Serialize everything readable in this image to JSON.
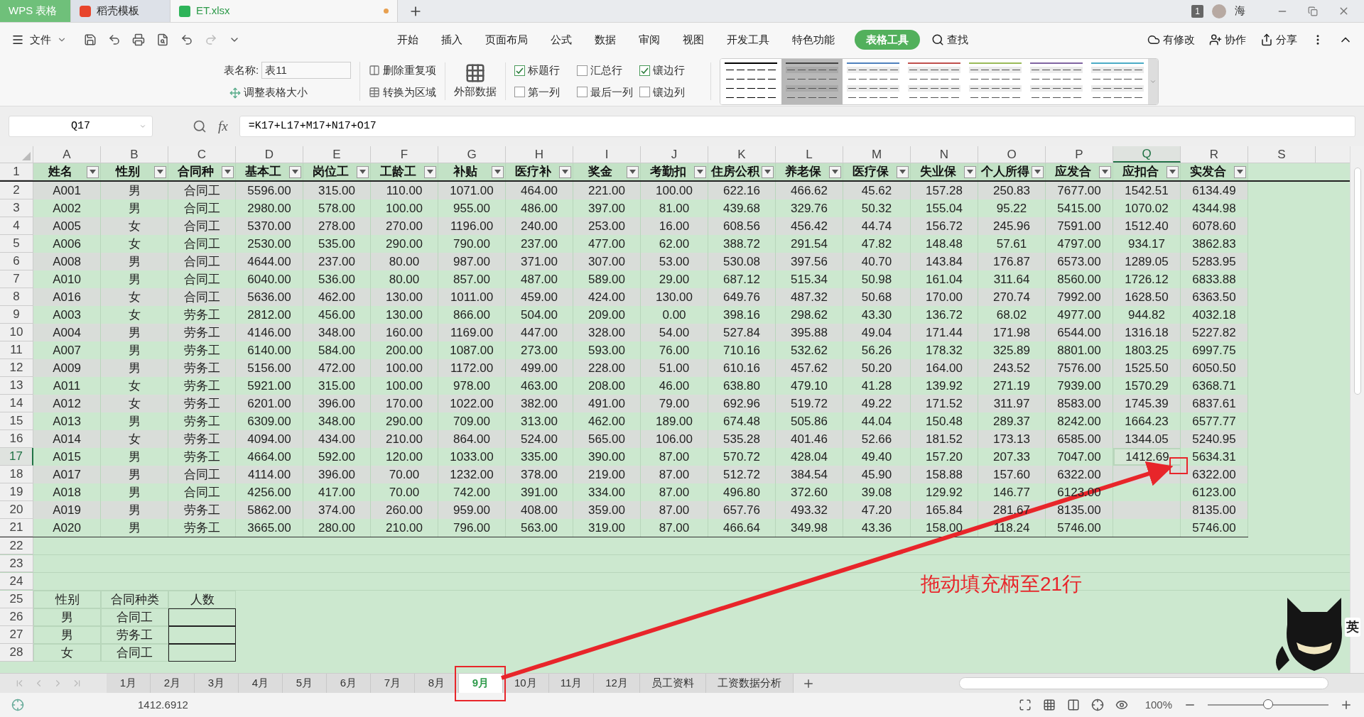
{
  "app_tabs": [
    {
      "label": "WPS 表格",
      "kind": "home",
      "selected": false
    },
    {
      "label": "稻壳模板",
      "kind": "docer",
      "selected": false
    },
    {
      "label": "ET.xlsx",
      "kind": "file",
      "selected": true
    }
  ],
  "title_bar": {
    "badge": "1",
    "user": "海"
  },
  "menu": {
    "file": "文件",
    "tabs": [
      {
        "label": "开始",
        "selected": false
      },
      {
        "label": "插入",
        "selected": false
      },
      {
        "label": "页面布局",
        "selected": false
      },
      {
        "label": "公式",
        "selected": false
      },
      {
        "label": "数据",
        "selected": false
      },
      {
        "label": "审阅",
        "selected": false
      },
      {
        "label": "视图",
        "selected": false
      },
      {
        "label": "开发工具",
        "selected": false
      },
      {
        "label": "特色功能",
        "selected": false
      },
      {
        "label": "表格工具",
        "selected": true
      }
    ],
    "search": "查找",
    "actions": [
      "有修改",
      "协作",
      "分享"
    ]
  },
  "ribbon": {
    "table_name_label": "表名称:",
    "table_name": "表11",
    "resize": "调整表格大小",
    "remove_duplicates": "删除重复项",
    "convert": "转换为区域",
    "external_data": "外部数据",
    "options": [
      {
        "label": "标题行",
        "checked": true
      },
      {
        "label": "汇总行",
        "checked": false
      },
      {
        "label": "镶边行",
        "checked": true
      },
      {
        "label": "第一列",
        "checked": false
      },
      {
        "label": "最后一列",
        "checked": false
      },
      {
        "label": "镶边列",
        "checked": false
      }
    ],
    "styles": [
      {
        "color": "#000000",
        "selected": false
      },
      {
        "color": "#444444",
        "selected": true
      },
      {
        "color": "#4f81bd",
        "selected": false
      },
      {
        "color": "#c0504d",
        "selected": false
      },
      {
        "color": "#9bbb59",
        "selected": false
      },
      {
        "color": "#8064a2",
        "selected": false
      },
      {
        "color": "#4bacc6",
        "selected": false
      }
    ]
  },
  "formula_bar": {
    "cell": "Q17",
    "fx": "fx",
    "formula": "=K17+L17+M17+N17+O17"
  },
  "sheet": {
    "columns": [
      {
        "label": "A",
        "selected": false
      },
      {
        "label": "B",
        "selected": false
      },
      {
        "label": "C",
        "selected": false
      },
      {
        "label": "D",
        "selected": false
      },
      {
        "label": "E",
        "selected": false
      },
      {
        "label": "F",
        "selected": false
      },
      {
        "label": "G",
        "selected": false
      },
      {
        "label": "H",
        "selected": false
      },
      {
        "label": "I",
        "selected": false
      },
      {
        "label": "J",
        "selected": false
      },
      {
        "label": "K",
        "selected": false
      },
      {
        "label": "L",
        "selected": false
      },
      {
        "label": "M",
        "selected": false
      },
      {
        "label": "N",
        "selected": false
      },
      {
        "label": "O",
        "selected": false
      },
      {
        "label": "P",
        "selected": false
      },
      {
        "label": "Q",
        "selected": true
      },
      {
        "label": "R",
        "selected": false
      },
      {
        "label": "S",
        "selected": false
      }
    ],
    "header_row": {
      "number": "1",
      "cells": [
        "姓名",
        "性别",
        "合同种",
        "基本工",
        "岗位工",
        "工龄工",
        "补贴",
        "医疗补",
        "奖金",
        "考勤扣",
        "住房公积",
        "养老保",
        "医疗保",
        "失业保",
        "个人所得",
        "应发合",
        "应扣合",
        "实发合"
      ]
    },
    "rows": [
      {
        "number": "2",
        "selected": false,
        "cells": [
          "A001",
          "男",
          "合同工",
          "5596.00",
          "315.00",
          "110.00",
          "1071.00",
          "464.00",
          "221.00",
          "100.00",
          "622.16",
          "466.62",
          "45.62",
          "157.28",
          "250.83",
          "7677.00",
          "1542.51",
          "6134.49"
        ]
      },
      {
        "number": "3",
        "selected": false,
        "cells": [
          "A002",
          "男",
          "合同工",
          "2980.00",
          "578.00",
          "100.00",
          "955.00",
          "486.00",
          "397.00",
          "81.00",
          "439.68",
          "329.76",
          "50.32",
          "155.04",
          "95.22",
          "5415.00",
          "1070.02",
          "4344.98"
        ]
      },
      {
        "number": "4",
        "selected": false,
        "cells": [
          "A005",
          "女",
          "合同工",
          "5370.00",
          "278.00",
          "270.00",
          "1196.00",
          "240.00",
          "253.00",
          "16.00",
          "608.56",
          "456.42",
          "44.74",
          "156.72",
          "245.96",
          "7591.00",
          "1512.40",
          "6078.60"
        ]
      },
      {
        "number": "5",
        "selected": false,
        "cells": [
          "A006",
          "女",
          "合同工",
          "2530.00",
          "535.00",
          "290.00",
          "790.00",
          "237.00",
          "477.00",
          "62.00",
          "388.72",
          "291.54",
          "47.82",
          "148.48",
          "57.61",
          "4797.00",
          "934.17",
          "3862.83"
        ]
      },
      {
        "number": "6",
        "selected": false,
        "cells": [
          "A008",
          "男",
          "合同工",
          "4644.00",
          "237.00",
          "80.00",
          "987.00",
          "371.00",
          "307.00",
          "53.00",
          "530.08",
          "397.56",
          "40.70",
          "143.84",
          "176.87",
          "6573.00",
          "1289.05",
          "5283.95"
        ]
      },
      {
        "number": "7",
        "selected": false,
        "cells": [
          "A010",
          "男",
          "合同工",
          "6040.00",
          "536.00",
          "80.00",
          "857.00",
          "487.00",
          "589.00",
          "29.00",
          "687.12",
          "515.34",
          "50.98",
          "161.04",
          "311.64",
          "8560.00",
          "1726.12",
          "6833.88"
        ]
      },
      {
        "number": "8",
        "selected": false,
        "cells": [
          "A016",
          "女",
          "合同工",
          "5636.00",
          "462.00",
          "130.00",
          "1011.00",
          "459.00",
          "424.00",
          "130.00",
          "649.76",
          "487.32",
          "50.68",
          "170.00",
          "270.74",
          "7992.00",
          "1628.50",
          "6363.50"
        ]
      },
      {
        "number": "9",
        "selected": false,
        "cells": [
          "A003",
          "女",
          "劳务工",
          "2812.00",
          "456.00",
          "130.00",
          "866.00",
          "504.00",
          "209.00",
          "0.00",
          "398.16",
          "298.62",
          "43.30",
          "136.72",
          "68.02",
          "4977.00",
          "944.82",
          "4032.18"
        ]
      },
      {
        "number": "10",
        "selected": false,
        "cells": [
          "A004",
          "男",
          "劳务工",
          "4146.00",
          "348.00",
          "160.00",
          "1169.00",
          "447.00",
          "328.00",
          "54.00",
          "527.84",
          "395.88",
          "49.04",
          "171.44",
          "171.98",
          "6544.00",
          "1316.18",
          "5227.82"
        ]
      },
      {
        "number": "11",
        "selected": false,
        "cells": [
          "A007",
          "男",
          "劳务工",
          "6140.00",
          "584.00",
          "200.00",
          "1087.00",
          "273.00",
          "593.00",
          "76.00",
          "710.16",
          "532.62",
          "56.26",
          "178.32",
          "325.89",
          "8801.00",
          "1803.25",
          "6997.75"
        ]
      },
      {
        "number": "12",
        "selected": false,
        "cells": [
          "A009",
          "男",
          "劳务工",
          "5156.00",
          "472.00",
          "100.00",
          "1172.00",
          "499.00",
          "228.00",
          "51.00",
          "610.16",
          "457.62",
          "50.20",
          "164.00",
          "243.52",
          "7576.00",
          "1525.50",
          "6050.50"
        ]
      },
      {
        "number": "13",
        "selected": false,
        "cells": [
          "A011",
          "女",
          "劳务工",
          "5921.00",
          "315.00",
          "100.00",
          "978.00",
          "463.00",
          "208.00",
          "46.00",
          "638.80",
          "479.10",
          "41.28",
          "139.92",
          "271.19",
          "7939.00",
          "1570.29",
          "6368.71"
        ]
      },
      {
        "number": "14",
        "selected": false,
        "cells": [
          "A012",
          "女",
          "劳务工",
          "6201.00",
          "396.00",
          "170.00",
          "1022.00",
          "382.00",
          "491.00",
          "79.00",
          "692.96",
          "519.72",
          "49.22",
          "171.52",
          "311.97",
          "8583.00",
          "1745.39",
          "6837.61"
        ]
      },
      {
        "number": "15",
        "selected": false,
        "cells": [
          "A013",
          "男",
          "劳务工",
          "6309.00",
          "348.00",
          "290.00",
          "709.00",
          "313.00",
          "462.00",
          "189.00",
          "674.48",
          "505.86",
          "44.04",
          "150.48",
          "289.37",
          "8242.00",
          "1664.23",
          "6577.77"
        ]
      },
      {
        "number": "16",
        "selected": false,
        "cells": [
          "A014",
          "女",
          "劳务工",
          "4094.00",
          "434.00",
          "210.00",
          "864.00",
          "524.00",
          "565.00",
          "106.00",
          "535.28",
          "401.46",
          "52.66",
          "181.52",
          "173.13",
          "6585.00",
          "1344.05",
          "5240.95"
        ]
      },
      {
        "number": "17",
        "selected": true,
        "cells": [
          "A015",
          "男",
          "劳务工",
          "4664.00",
          "592.00",
          "120.00",
          "1033.00",
          "335.00",
          "390.00",
          "87.00",
          "570.72",
          "428.04",
          "49.40",
          "157.20",
          "207.33",
          "7047.00",
          "1412.69",
          "5634.31"
        ]
      },
      {
        "number": "18",
        "selected": false,
        "cells": [
          "A017",
          "男",
          "合同工",
          "4114.00",
          "396.00",
          "70.00",
          "1232.00",
          "378.00",
          "219.00",
          "87.00",
          "512.72",
          "384.54",
          "45.90",
          "158.88",
          "157.60",
          "6322.00",
          null,
          "6322.00"
        ]
      },
      {
        "number": "19",
        "selected": false,
        "cells": [
          "A018",
          "男",
          "合同工",
          "4256.00",
          "417.00",
          "70.00",
          "742.00",
          "391.00",
          "334.00",
          "87.00",
          "496.80",
          "372.60",
          "39.08",
          "129.92",
          "146.77",
          "6123.00",
          null,
          "6123.00"
        ]
      },
      {
        "number": "20",
        "selected": false,
        "cells": [
          "A019",
          "男",
          "劳务工",
          "5862.00",
          "374.00",
          "260.00",
          "959.00",
          "408.00",
          "359.00",
          "87.00",
          "657.76",
          "493.32",
          "47.20",
          "165.84",
          "281.67",
          "8135.00",
          null,
          "8135.00"
        ]
      },
      {
        "number": "21",
        "selected": false,
        "cells": [
          "A020",
          "男",
          "劳务工",
          "3665.00",
          "280.00",
          "210.00",
          "796.00",
          "563.00",
          "319.00",
          "87.00",
          "466.64",
          "349.98",
          "43.36",
          "158.00",
          "118.24",
          "5746.00",
          null,
          "5746.00"
        ]
      }
    ],
    "empty_rows": [
      "22",
      "23",
      "24"
    ],
    "summary": {
      "header_number": "25",
      "header": [
        "性别",
        "合同种类",
        "人数"
      ],
      "rows": [
        {
          "number": "26",
          "cells": [
            "男",
            "合同工"
          ]
        },
        {
          "number": "27",
          "cells": [
            "男",
            "劳务工"
          ]
        },
        {
          "number": "28",
          "cells": [
            "女",
            "合同工"
          ]
        }
      ]
    }
  },
  "annotation": "拖动填充柄至21行",
  "ime": "英",
  "sheet_tabs": [
    {
      "label": "1月",
      "selected": false
    },
    {
      "label": "2月",
      "selected": false
    },
    {
      "label": "3月",
      "selected": false
    },
    {
      "label": "4月",
      "selected": false
    },
    {
      "label": "5月",
      "selected": false
    },
    {
      "label": "6月",
      "selected": false
    },
    {
      "label": "7月",
      "selected": false
    },
    {
      "label": "8月",
      "selected": false
    },
    {
      "label": "9月",
      "selected": true
    },
    {
      "label": "10月",
      "selected": false
    },
    {
      "label": "11月",
      "selected": false
    },
    {
      "label": "12月",
      "selected": false
    },
    {
      "label": "员工资料",
      "selected": false
    },
    {
      "label": "工资数据分析",
      "selected": false
    }
  ],
  "status_bar": {
    "value": "1412.6912",
    "zoom": "100%",
    "zoom_slider": {
      "level": 0.5
    }
  }
}
